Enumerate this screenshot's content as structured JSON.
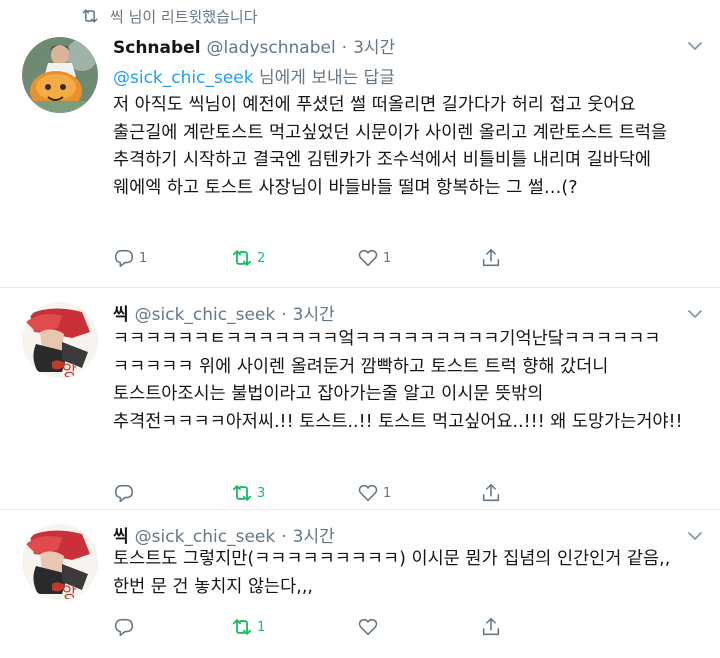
{
  "social_context": {
    "text": "씩 님이 리트윗했습니다",
    "icon": "retweet-icon"
  },
  "colors": {
    "link": "#1da1f2",
    "retweet_active": "#17bf63",
    "secondary": "#657786",
    "divider": "#e6ecf0"
  },
  "tweets": [
    {
      "display_name": "Schnabel",
      "handle": "@ladyschnabel",
      "dot": "·",
      "time": "3시간",
      "reply_to_handle": "@sick_chic_seek",
      "reply_to_suffix": " 님에게 보내는 답글",
      "text": "저 아직도 씩님이 예전에 푸셨던 썰 떠올리면 길가다가 허리 접고 웃어요 출근길에 계란토스트 먹고싶었던 시문이가 사이렌 올리고 계란토스트 트럭을 추격하기 시작하고 결국엔 김텐카가 조수석에서 비틀비틀 내리며 길바닥에 웨에엑 하고 토스트 사장님이 바들바들 떨며 항복하는 그 썰…(?",
      "reply_count": "1",
      "retweet_count": "2",
      "like_count": "1"
    },
    {
      "display_name": "씩",
      "handle": "@sick_chic_seek",
      "dot": "·",
      "time": "3시간",
      "text": "ㅋㅋㅋㅋㅋㅋㅌㅋㅋㅋㅋㅋㅋㅋ엌ㅋㅋㅋㅋㅋㅋㅋㅋㅋ기억난닼ㅋㅋㅋㅋㅋㅋ ㅋㅋㅋㅋㅋ 위에 사이렌 올려둔거 깜빡하고 토스트 트럭 향해 갔더니 토스트아조시는 불법이라고 잡아가는줄 알고 이시문 뜻밖의 추격전ㅋㅋㅋㅋ아저씨.!! 토스트..!! 토스트 먹고싶어요..!!! 왜 도망가는거야!!",
      "reply_count": "",
      "retweet_count": "3",
      "like_count": "1"
    },
    {
      "display_name": "씩",
      "handle": "@sick_chic_seek",
      "dot": "·",
      "time": "3시간",
      "text": "토스트도 그렇지만(ㅋㅋㅋㅋㅋㅋㅋㅋㅋ) 이시문 뭔가 집념의 인간인거 같음,, 한번 문 건 놓치지 않는다,,,",
      "reply_count": "",
      "retweet_count": "1",
      "like_count": ""
    }
  ]
}
